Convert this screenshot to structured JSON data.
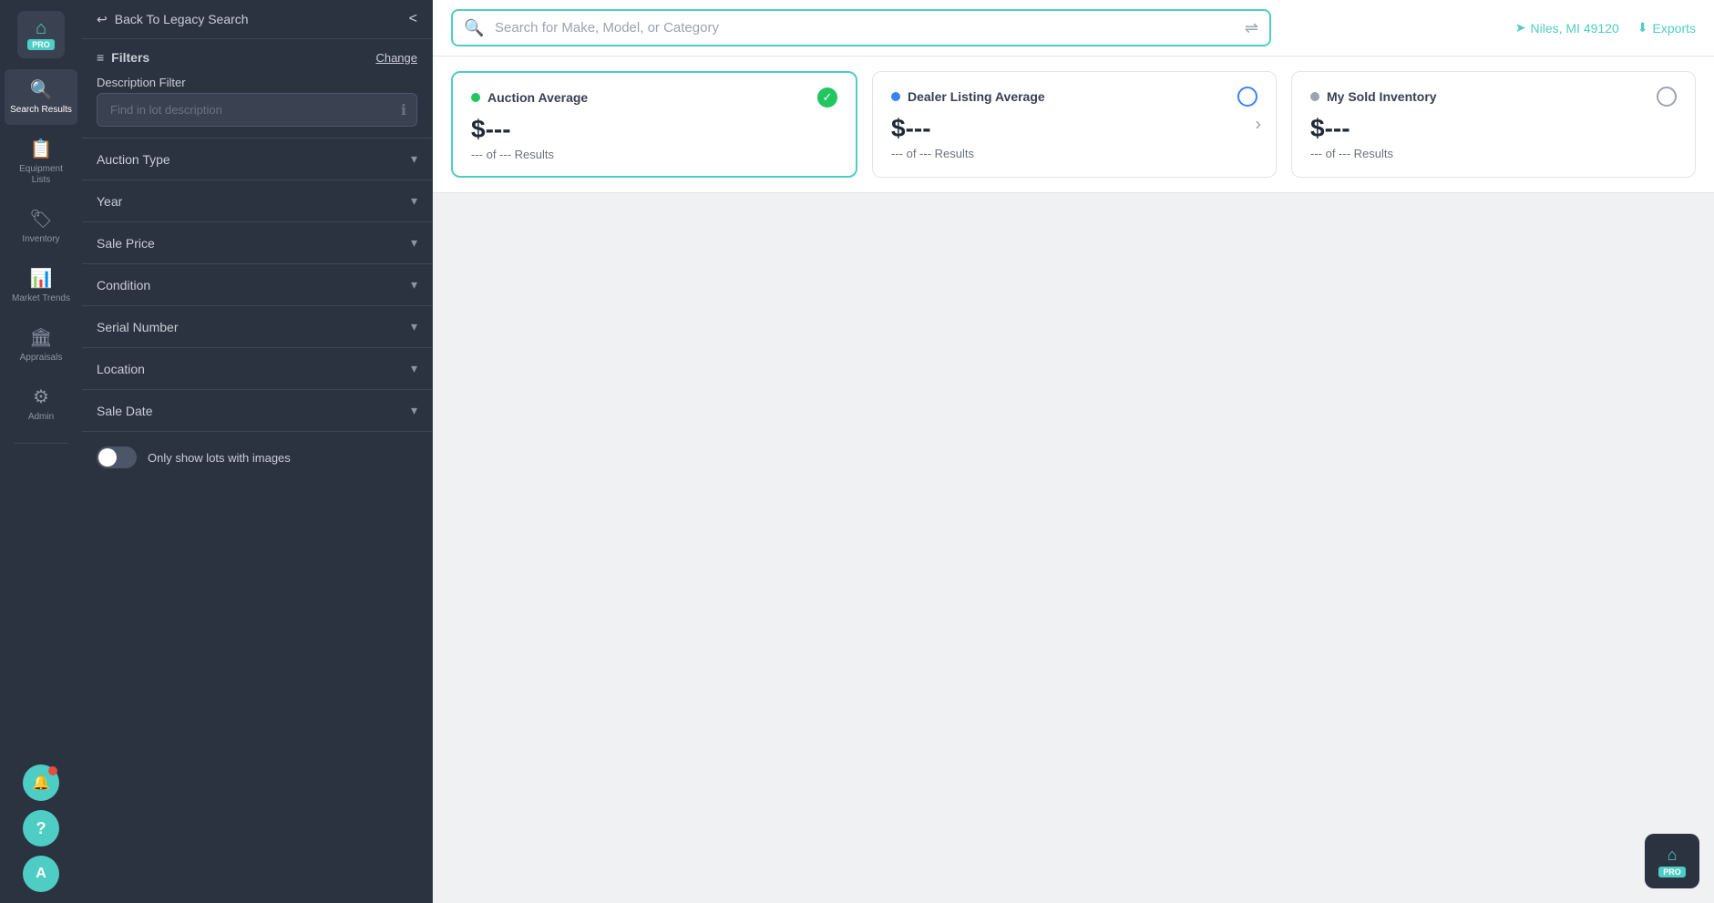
{
  "nav": {
    "logo_icon": "⌂",
    "pro_badge": "PRO",
    "items": [
      {
        "id": "search-results",
        "icon": "🔍",
        "label": "Search\nResults",
        "active": true
      },
      {
        "id": "equipment-lists",
        "icon": "📋",
        "label": "Equipment\nLists",
        "active": false
      },
      {
        "id": "inventory",
        "icon": "🏷",
        "label": "Inventory",
        "active": false
      },
      {
        "id": "market-trends",
        "icon": "📊",
        "label": "Market\nTrends",
        "active": false
      },
      {
        "id": "appraisals",
        "icon": "🏛",
        "label": "Appraisals",
        "active": false
      },
      {
        "id": "admin",
        "icon": "⚙",
        "label": "Admin",
        "active": false
      }
    ],
    "bell_icon": "🔔",
    "help_icon": "?",
    "avatar_label": "A",
    "pro_corner_icon": "⌂",
    "pro_corner_badge": "PRO"
  },
  "filter_panel": {
    "back_button": "Back To Legacy Search",
    "collapse_icon": "<",
    "filters_label": "Filters",
    "change_link": "Change",
    "description_filter_label": "Description Filter",
    "description_placeholder": "Find in lot description",
    "info_icon": "ℹ",
    "sections": [
      {
        "id": "auction-type",
        "label": "Auction Type"
      },
      {
        "id": "year",
        "label": "Year"
      },
      {
        "id": "sale-price",
        "label": "Sale Price"
      },
      {
        "id": "condition",
        "label": "Condition"
      },
      {
        "id": "serial-number",
        "label": "Serial Number"
      },
      {
        "id": "location",
        "label": "Location"
      },
      {
        "id": "sale-date",
        "label": "Sale Date"
      }
    ],
    "toggle_label": "Only show lots with images",
    "toggle_on": false
  },
  "topbar": {
    "search_placeholder": "Search for Make, Model, or Category",
    "location": "Niles, MI 49120",
    "export_label": "Exports"
  },
  "cards": [
    {
      "id": "auction-average",
      "dot_type": "green",
      "title": "Auction Average",
      "check_type": "check-green",
      "price": "$---",
      "results": "--- of --- Results",
      "active": true,
      "has_arrow": false
    },
    {
      "id": "dealer-listing-average",
      "dot_type": "blue",
      "title": "Dealer Listing Average",
      "check_type": "circle-blue",
      "price": "$---",
      "results": "--- of --- Results",
      "active": false,
      "has_arrow": true
    },
    {
      "id": "my-sold-inventory",
      "dot_type": "gray",
      "title": "My Sold Inventory",
      "check_type": "circle-gray",
      "price": "$---",
      "results": "--- of --- Results",
      "active": false,
      "has_arrow": false
    }
  ]
}
